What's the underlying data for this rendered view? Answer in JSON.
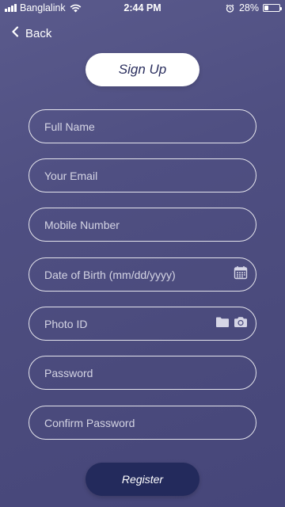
{
  "status_bar": {
    "carrier": "Banglalink",
    "time": "2:44 PM",
    "battery": "28%",
    "battery_level": 0.28
  },
  "nav": {
    "back_label": "Back"
  },
  "title": "Sign Up",
  "form": {
    "fields": [
      {
        "placeholder": "Full Name"
      },
      {
        "placeholder": "Your Email"
      },
      {
        "placeholder": "Mobile Number"
      },
      {
        "placeholder": "Date of Birth (mm/dd/yyyy)",
        "icon": "calendar-icon"
      },
      {
        "placeholder": "Photo ID",
        "icons": [
          "folder-icon",
          "camera-icon"
        ]
      },
      {
        "placeholder": "Password"
      },
      {
        "placeholder": "Confirm Password"
      }
    ],
    "submit_label": "Register"
  },
  "colors": {
    "background": "#4f4f82",
    "title_pill_bg": "#ffffff",
    "title_text": "#2a2e5e",
    "register_bg": "#232a5c"
  }
}
